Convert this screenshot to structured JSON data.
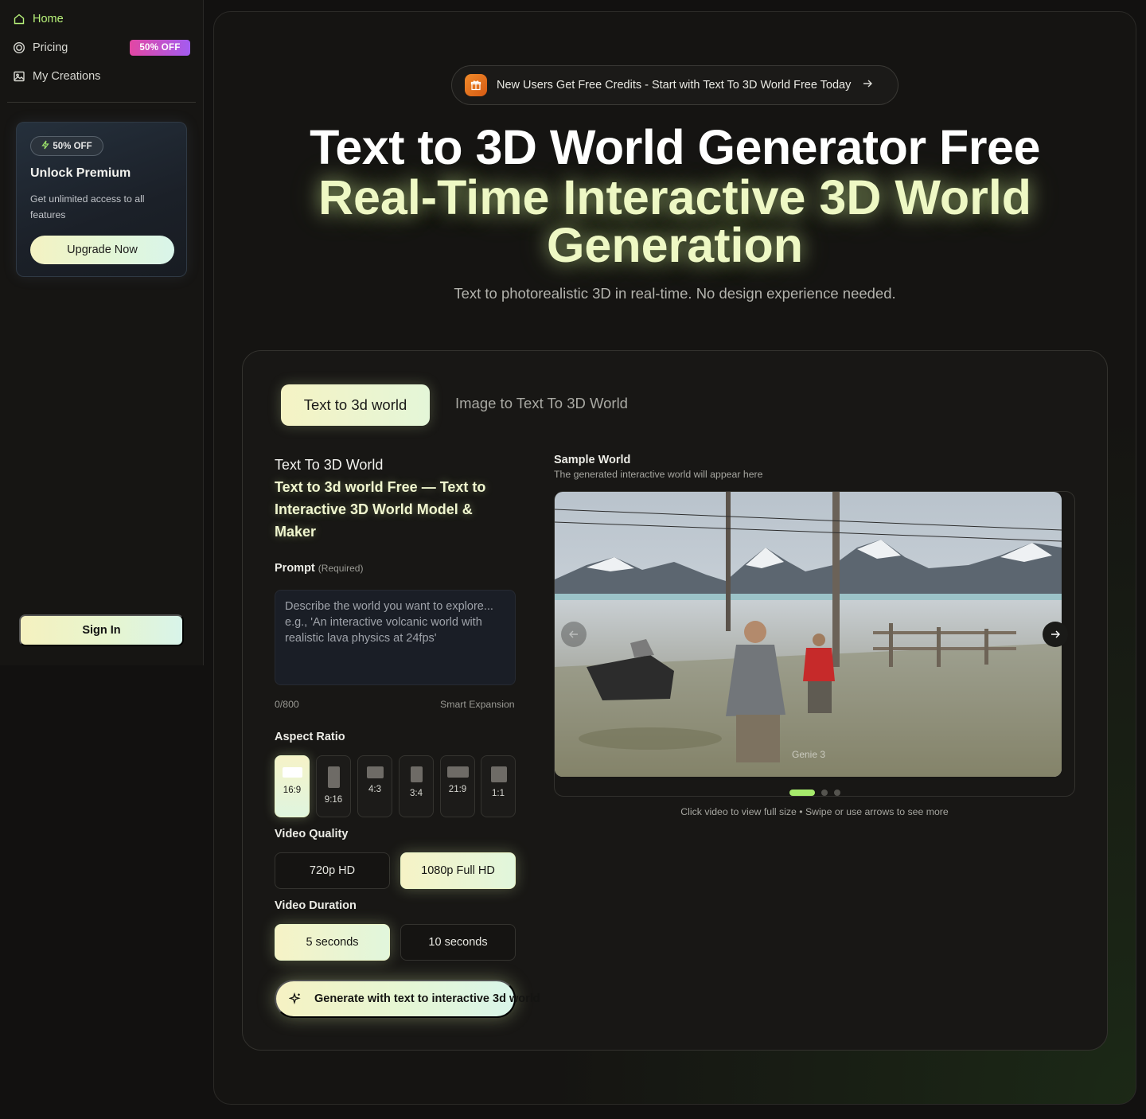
{
  "sidebar": {
    "nav": [
      {
        "label": "Home",
        "icon": "home-icon",
        "active": true
      },
      {
        "label": "Pricing",
        "icon": "dollar-circle-icon",
        "badge": "50% OFF"
      },
      {
        "label": "My Creations",
        "icon": "image-icon"
      }
    ],
    "premium": {
      "badge": "50% OFF",
      "title": "Unlock Premium",
      "description": "Get unlimited access to all features",
      "button": "Upgrade Now"
    },
    "sign_in": "Sign In"
  },
  "announcement": {
    "text": "New Users Get Free Credits - Start with Text To 3D World Free Today",
    "icon": "gift-icon"
  },
  "hero": {
    "title": "Text to 3D World Generator Free",
    "subtitle_highlight": "Real-Time Interactive 3D World Generation",
    "description": "Text to photorealistic 3D in real-time. No design experience needed."
  },
  "tabs": [
    {
      "label": "Text to 3d world",
      "active": true
    },
    {
      "label": "Image to Text To 3D World",
      "active": false
    }
  ],
  "form": {
    "heading_line1": "Text To 3D World",
    "heading_line2": "Text to 3d world Free — Text to Interactive 3D World Model & Maker",
    "prompt_label": "Prompt",
    "prompt_required": "(Required)",
    "prompt_placeholder": "Describe the world you want to explore... e.g., 'An interactive volcanic world with realistic lava physics at 24fps'",
    "prompt_value": "",
    "char_count": "0/800",
    "smart_expansion": "Smart Expansion",
    "aspect_ratio_label": "Aspect Ratio",
    "aspect_ratios": [
      {
        "label": "16:9",
        "active": true
      },
      {
        "label": "9:16",
        "active": false
      },
      {
        "label": "4:3",
        "active": false
      },
      {
        "label": "3:4",
        "active": false
      },
      {
        "label": "21:9",
        "active": false
      },
      {
        "label": "1:1",
        "active": false
      }
    ],
    "video_quality_label": "Video Quality",
    "video_quality": [
      {
        "label": "720p HD",
        "active": false
      },
      {
        "label": "1080p Full HD",
        "active": true
      }
    ],
    "video_duration_label": "Video Duration",
    "video_duration": [
      {
        "label": "5 seconds",
        "active": true
      },
      {
        "label": "10 seconds",
        "active": false
      }
    ],
    "generate_button": "Generate with text to interactive 3d world"
  },
  "sample": {
    "title": "Sample World",
    "subtitle": "The generated interactive world will appear here",
    "watermark": "Genie 3",
    "slide_count": 3,
    "active_slide": 1,
    "hint": "Click video to view full size • Swipe or use arrows to see more"
  },
  "colors": {
    "accent_green": "#b8f27a",
    "highlight_text": "#eef8c4",
    "badge_gradient_start": "#e247a3",
    "badge_gradient_end": "#a35cf0",
    "background": "#121110"
  }
}
